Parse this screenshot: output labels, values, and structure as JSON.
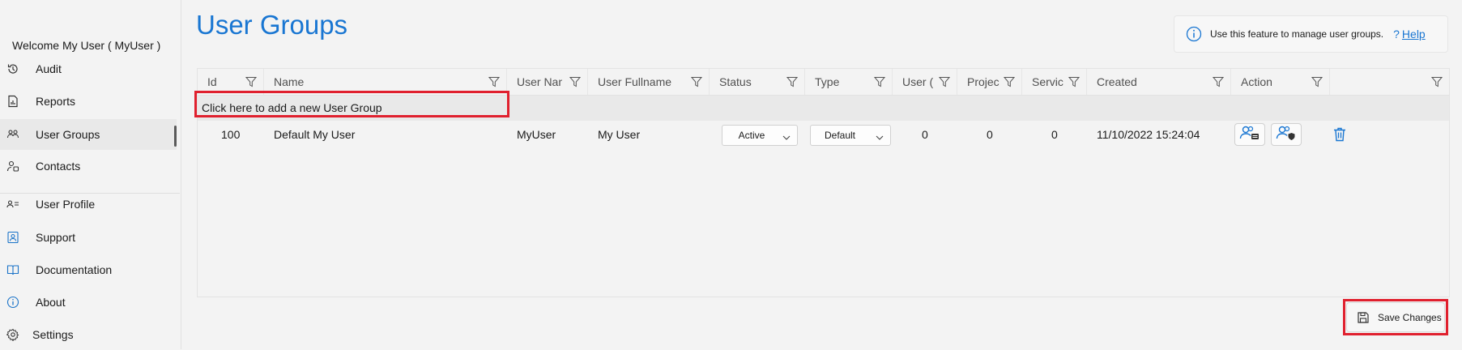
{
  "sidebar": {
    "welcome": "Welcome  My User  ( MyUser )",
    "items": [
      {
        "label": "Audit",
        "icon": "history-icon"
      },
      {
        "label": "Reports",
        "icon": "report-icon"
      },
      {
        "label": "User Groups",
        "icon": "user-groups-icon",
        "active": true
      },
      {
        "label": "Contacts",
        "icon": "contacts-icon"
      },
      {
        "label": "User Profile",
        "icon": "user-profile-icon"
      },
      {
        "label": "Support",
        "icon": "support-icon"
      },
      {
        "label": "Documentation",
        "icon": "book-icon"
      },
      {
        "label": "About",
        "icon": "info-icon"
      },
      {
        "label": "Settings",
        "icon": "gear-icon"
      }
    ]
  },
  "page": {
    "title": "User Groups",
    "info_text": "Use this feature to manage user groups.",
    "help_q": "?",
    "help_label": "Help"
  },
  "grid": {
    "columns": [
      "Id",
      "Name",
      "User Nan",
      "User Fullname",
      "Status",
      "Type",
      "User (",
      "Projec",
      "Servic",
      "Created",
      "Action",
      ""
    ],
    "add_row_label": "Click here to add a new User Group",
    "rows": [
      {
        "id": "100",
        "name": "Default My User",
        "user_name": "MyUser",
        "user_fullname": "My User",
        "status": "Active",
        "type": "Default",
        "user_count": "0",
        "project_count": "0",
        "service_count": "0",
        "created": "11/10/2022 15:24:04"
      }
    ]
  },
  "footer": {
    "save_label": "Save Changes"
  },
  "colors": {
    "accent": "#1976d2",
    "highlight": "#e0202e",
    "background": "#f3f3f3"
  }
}
